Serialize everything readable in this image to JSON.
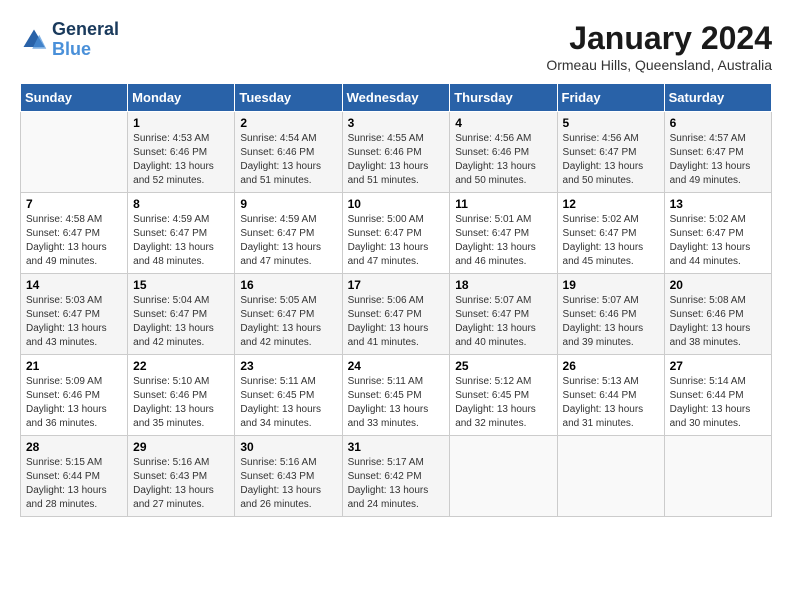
{
  "app": {
    "name_line1": "General",
    "name_line2": "Blue"
  },
  "title": "January 2024",
  "location": "Ormeau Hills, Queensland, Australia",
  "header": {
    "days": [
      "Sunday",
      "Monday",
      "Tuesday",
      "Wednesday",
      "Thursday",
      "Friday",
      "Saturday"
    ]
  },
  "weeks": [
    [
      {
        "day": "",
        "sunrise": "",
        "sunset": "",
        "daylight": ""
      },
      {
        "day": "1",
        "sunrise": "Sunrise: 4:53 AM",
        "sunset": "Sunset: 6:46 PM",
        "daylight": "Daylight: 13 hours and 52 minutes."
      },
      {
        "day": "2",
        "sunrise": "Sunrise: 4:54 AM",
        "sunset": "Sunset: 6:46 PM",
        "daylight": "Daylight: 13 hours and 51 minutes."
      },
      {
        "day": "3",
        "sunrise": "Sunrise: 4:55 AM",
        "sunset": "Sunset: 6:46 PM",
        "daylight": "Daylight: 13 hours and 51 minutes."
      },
      {
        "day": "4",
        "sunrise": "Sunrise: 4:56 AM",
        "sunset": "Sunset: 6:46 PM",
        "daylight": "Daylight: 13 hours and 50 minutes."
      },
      {
        "day": "5",
        "sunrise": "Sunrise: 4:56 AM",
        "sunset": "Sunset: 6:47 PM",
        "daylight": "Daylight: 13 hours and 50 minutes."
      },
      {
        "day": "6",
        "sunrise": "Sunrise: 4:57 AM",
        "sunset": "Sunset: 6:47 PM",
        "daylight": "Daylight: 13 hours and 49 minutes."
      }
    ],
    [
      {
        "day": "7",
        "sunrise": "Sunrise: 4:58 AM",
        "sunset": "Sunset: 6:47 PM",
        "daylight": "Daylight: 13 hours and 49 minutes."
      },
      {
        "day": "8",
        "sunrise": "Sunrise: 4:59 AM",
        "sunset": "Sunset: 6:47 PM",
        "daylight": "Daylight: 13 hours and 48 minutes."
      },
      {
        "day": "9",
        "sunrise": "Sunrise: 4:59 AM",
        "sunset": "Sunset: 6:47 PM",
        "daylight": "Daylight: 13 hours and 47 minutes."
      },
      {
        "day": "10",
        "sunrise": "Sunrise: 5:00 AM",
        "sunset": "Sunset: 6:47 PM",
        "daylight": "Daylight: 13 hours and 47 minutes."
      },
      {
        "day": "11",
        "sunrise": "Sunrise: 5:01 AM",
        "sunset": "Sunset: 6:47 PM",
        "daylight": "Daylight: 13 hours and 46 minutes."
      },
      {
        "day": "12",
        "sunrise": "Sunrise: 5:02 AM",
        "sunset": "Sunset: 6:47 PM",
        "daylight": "Daylight: 13 hours and 45 minutes."
      },
      {
        "day": "13",
        "sunrise": "Sunrise: 5:02 AM",
        "sunset": "Sunset: 6:47 PM",
        "daylight": "Daylight: 13 hours and 44 minutes."
      }
    ],
    [
      {
        "day": "14",
        "sunrise": "Sunrise: 5:03 AM",
        "sunset": "Sunset: 6:47 PM",
        "daylight": "Daylight: 13 hours and 43 minutes."
      },
      {
        "day": "15",
        "sunrise": "Sunrise: 5:04 AM",
        "sunset": "Sunset: 6:47 PM",
        "daylight": "Daylight: 13 hours and 42 minutes."
      },
      {
        "day": "16",
        "sunrise": "Sunrise: 5:05 AM",
        "sunset": "Sunset: 6:47 PM",
        "daylight": "Daylight: 13 hours and 42 minutes."
      },
      {
        "day": "17",
        "sunrise": "Sunrise: 5:06 AM",
        "sunset": "Sunset: 6:47 PM",
        "daylight": "Daylight: 13 hours and 41 minutes."
      },
      {
        "day": "18",
        "sunrise": "Sunrise: 5:07 AM",
        "sunset": "Sunset: 6:47 PM",
        "daylight": "Daylight: 13 hours and 40 minutes."
      },
      {
        "day": "19",
        "sunrise": "Sunrise: 5:07 AM",
        "sunset": "Sunset: 6:46 PM",
        "daylight": "Daylight: 13 hours and 39 minutes."
      },
      {
        "day": "20",
        "sunrise": "Sunrise: 5:08 AM",
        "sunset": "Sunset: 6:46 PM",
        "daylight": "Daylight: 13 hours and 38 minutes."
      }
    ],
    [
      {
        "day": "21",
        "sunrise": "Sunrise: 5:09 AM",
        "sunset": "Sunset: 6:46 PM",
        "daylight": "Daylight: 13 hours and 36 minutes."
      },
      {
        "day": "22",
        "sunrise": "Sunrise: 5:10 AM",
        "sunset": "Sunset: 6:46 PM",
        "daylight": "Daylight: 13 hours and 35 minutes."
      },
      {
        "day": "23",
        "sunrise": "Sunrise: 5:11 AM",
        "sunset": "Sunset: 6:45 PM",
        "daylight": "Daylight: 13 hours and 34 minutes."
      },
      {
        "day": "24",
        "sunrise": "Sunrise: 5:11 AM",
        "sunset": "Sunset: 6:45 PM",
        "daylight": "Daylight: 13 hours and 33 minutes."
      },
      {
        "day": "25",
        "sunrise": "Sunrise: 5:12 AM",
        "sunset": "Sunset: 6:45 PM",
        "daylight": "Daylight: 13 hours and 32 minutes."
      },
      {
        "day": "26",
        "sunrise": "Sunrise: 5:13 AM",
        "sunset": "Sunset: 6:44 PM",
        "daylight": "Daylight: 13 hours and 31 minutes."
      },
      {
        "day": "27",
        "sunrise": "Sunrise: 5:14 AM",
        "sunset": "Sunset: 6:44 PM",
        "daylight": "Daylight: 13 hours and 30 minutes."
      }
    ],
    [
      {
        "day": "28",
        "sunrise": "Sunrise: 5:15 AM",
        "sunset": "Sunset: 6:44 PM",
        "daylight": "Daylight: 13 hours and 28 minutes."
      },
      {
        "day": "29",
        "sunrise": "Sunrise: 5:16 AM",
        "sunset": "Sunset: 6:43 PM",
        "daylight": "Daylight: 13 hours and 27 minutes."
      },
      {
        "day": "30",
        "sunrise": "Sunrise: 5:16 AM",
        "sunset": "Sunset: 6:43 PM",
        "daylight": "Daylight: 13 hours and 26 minutes."
      },
      {
        "day": "31",
        "sunrise": "Sunrise: 5:17 AM",
        "sunset": "Sunset: 6:42 PM",
        "daylight": "Daylight: 13 hours and 24 minutes."
      },
      {
        "day": "",
        "sunrise": "",
        "sunset": "",
        "daylight": ""
      },
      {
        "day": "",
        "sunrise": "",
        "sunset": "",
        "daylight": ""
      },
      {
        "day": "",
        "sunrise": "",
        "sunset": "",
        "daylight": ""
      }
    ]
  ]
}
